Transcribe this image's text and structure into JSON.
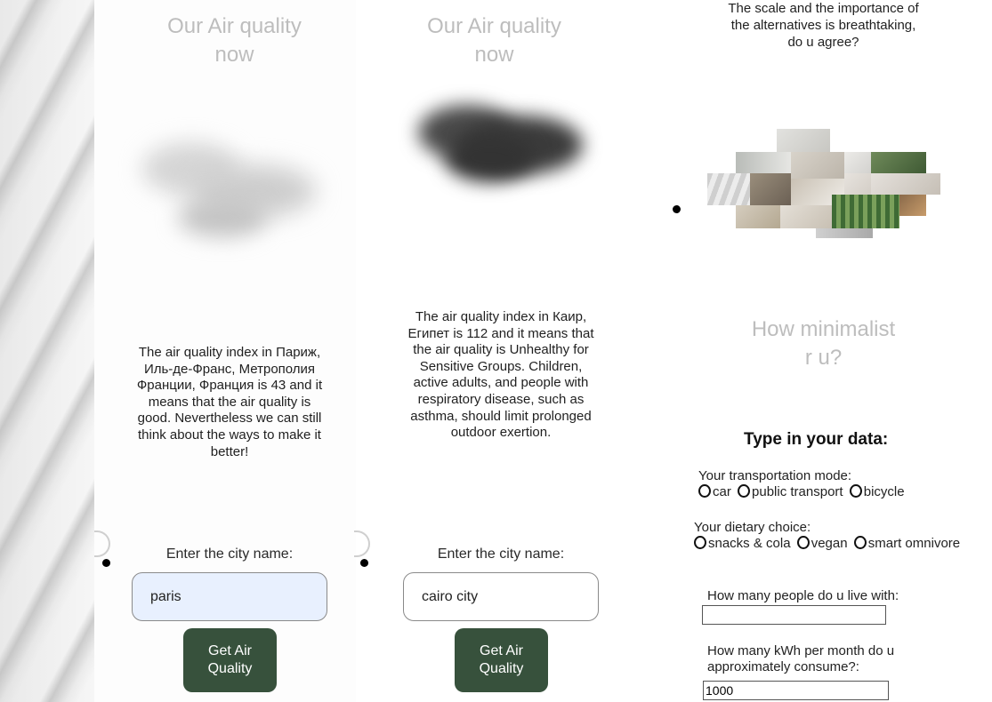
{
  "panels": [
    {
      "title": "Our Air quality now",
      "description": "The air quality index in Париж, Иль-де-Франс, Метрополия Франции, Франция is 43 and it means that the air quality is good. Nevertheless we can still think about the ways to make it better!",
      "city_label": "Enter the city name:",
      "city_value": "paris",
      "button_label": "Get Air Quality",
      "cloud_color": "#c9c9c9"
    },
    {
      "title": "Our Air quality now",
      "description": "The air quality index in Каир, Египет is 112 and it means that the air quality is Unhealthy for Sensitive Groups. Children, active adults, and people with respiratory disease, such as asthma, should limit prolonged outdoor exertion.",
      "city_label": "Enter the city name:",
      "city_value": "cairo city",
      "button_label": "Get Air Quality",
      "cloud_color": "#3a3a3a"
    }
  ],
  "right": {
    "question": "The scale and the importance of the alternatives is breathtaking, do u agree?",
    "minimalist_title": "How minimalist r u?",
    "form_title": "Type in your data:",
    "transport_label": "Your transportation mode:",
    "transport_options": [
      "car",
      "public transport",
      "bicycle"
    ],
    "diet_label": "Your dietary choice:",
    "diet_options": [
      "snacks & cola",
      "vegan",
      "smart omnivore"
    ],
    "people_label": "How many people do u live with:",
    "people_value": "",
    "kwh_label": "How many kWh per month do u approximately consume?:",
    "kwh_value": "1000"
  },
  "colors": {
    "button_green": "#37513c",
    "input_focus_bg": "#e8f0fe",
    "title_gray": "#bdbdbd"
  }
}
